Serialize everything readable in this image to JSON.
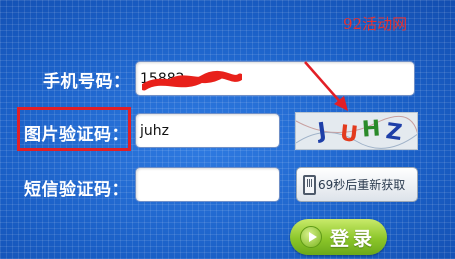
{
  "watermark": "92活动网",
  "phone": {
    "label": "手机号码：",
    "value": "15882"
  },
  "image_captcha": {
    "label": "图片验证码：",
    "value": "juhz",
    "characters": [
      {
        "char": "J",
        "color": "#1e3fa8"
      },
      {
        "char": "U",
        "color": "#e33b1e"
      },
      {
        "char": "H",
        "color": "#2a8a2a"
      },
      {
        "char": "Z",
        "color": "#1e3fa8"
      }
    ]
  },
  "sms_code": {
    "label": "短信验证码：",
    "value": "",
    "button_label": "69秒后重新获取"
  },
  "login": {
    "label": "登录"
  },
  "colors": {
    "background": "#1a5fc6",
    "annotation": "#e21f26",
    "login_button": "#8cc62a"
  }
}
